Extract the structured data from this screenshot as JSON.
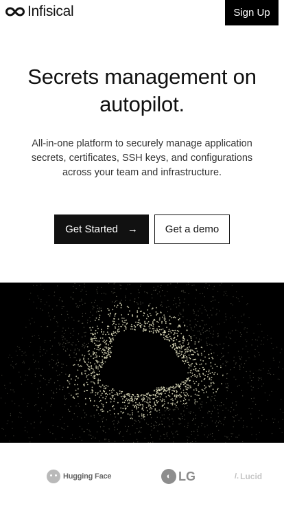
{
  "header": {
    "brand_name": "Infisical",
    "signup_label": "Sign Up"
  },
  "hero": {
    "title": "Secrets management on autopilot.",
    "subtitle": "All-in-one platform to securely manage application secrets, certificates, SSH keys, and configurations across your team and infrastructure.",
    "primary_cta": "Get Started",
    "primary_cta_icon": "arrow-right-icon",
    "secondary_cta": "Get a demo"
  },
  "visual": {
    "background": "#000000",
    "particle_color": "#e8e6c4"
  },
  "logos": [
    {
      "name": "Hugging Face",
      "icon": "hugging-face-logo"
    },
    {
      "name": "LG",
      "icon": "lg-logo"
    },
    {
      "name": "Lucid",
      "icon": "lucid-logo"
    }
  ],
  "colors": {
    "primary": "#111111",
    "on_primary": "#ffffff",
    "text_muted": "#333333"
  }
}
